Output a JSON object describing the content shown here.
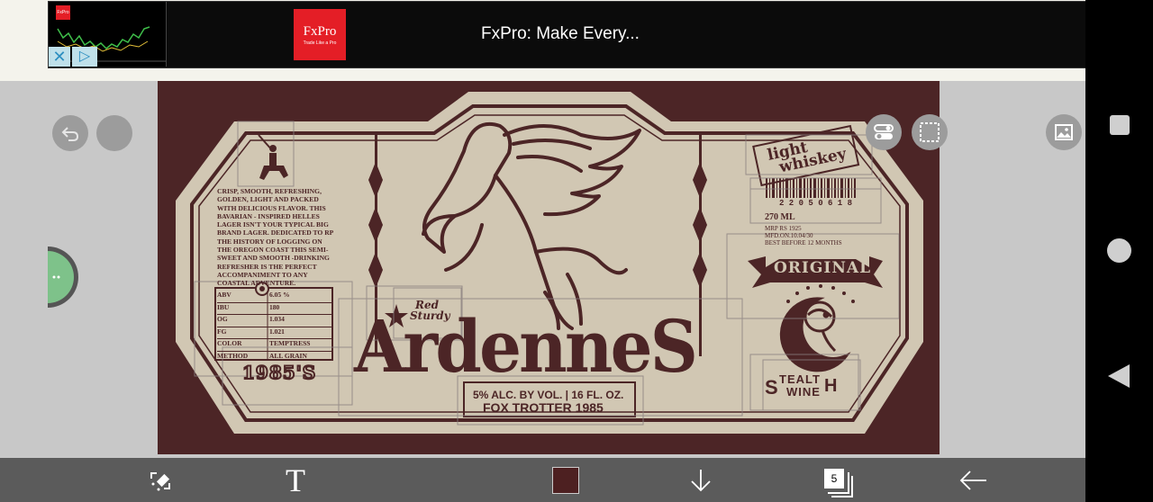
{
  "ad": {
    "thumb_brand": "FxPro",
    "logo_name": "FxPro",
    "logo_tagline": "Trade Like a Pro",
    "title": "FxPro: Make Every...",
    "close_glyph": "✕",
    "play_glyph": "▷"
  },
  "label": {
    "description": "CRISP, SMOOTH, REFRESHING, GOLDEN, LIGHT  AND PACKED WITH DELICIOUS FLAVOR. THIS BAVARIAN - INSPIRED  HELLES LAGER ISN'T YOUR TYPICAL BIG BRAND LAGER. DEDICATED TO RP THE HISTORY OF LOGGING ON THE OREGON COAST THIS SEMI-  SWEET AND  SMOOTH -DRINKING REFRESHER IS THE PERFECT  ACCOMPANIMENT TO ANY COASTAL ADVENTURE.",
    "specs": [
      {
        "k": "ABV",
        "v": "6.05 %"
      },
      {
        "k": "IBU",
        "v": "180"
      },
      {
        "k": "OG",
        "v": "1.034"
      },
      {
        "k": "FG",
        "v": "1.021"
      },
      {
        "k": "COLOR",
        "v": "TEMPTRESS"
      },
      {
        "k": "METHOD",
        "v": "ALL GRAIN"
      }
    ],
    "year_badge": "1985'S",
    "red_sturdy_1": "Red",
    "red_sturdy_2": "Sturdy",
    "brand": "ArdenneS",
    "alc_line": "5% ALC. BY VOL. | 16 FL. OZ.",
    "fox_line": "FOX  TROTTER  1985",
    "light_whiskey_1": "light",
    "light_whiskey_2": "whiskey",
    "barcode_number": "2 2 0 5 0 6 1 8",
    "volume": "270 ML",
    "mrp": "MRP RS 1925",
    "mfd": "MFD.ON.10.04/30",
    "best_before": "BEST BEFORE 12 MONTHS",
    "original": "ORIGINAL",
    "stealth_s": "S",
    "stealth_mid": "TEALT",
    "stealth_h": "H",
    "stealth_wine": "WINE"
  },
  "toolbar": {
    "text_tool": "T",
    "layers_count": "5",
    "swatch_color": "#4d2021"
  },
  "colors": {
    "label_bg": "#4c2526",
    "label_cream": "#d1c7b3",
    "accent_red": "#e41e26"
  }
}
